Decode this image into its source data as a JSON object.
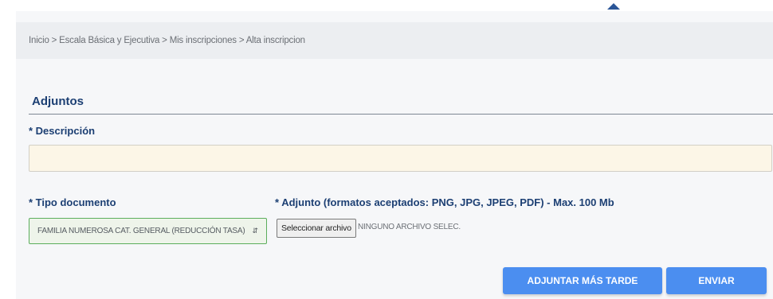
{
  "breadcrumb": {
    "text": "Inicio > Escala Básica y Ejecutiva > Mis inscripciones > Alta inscripcion"
  },
  "section": {
    "title": "Adjuntos"
  },
  "form": {
    "descripcion_label": "* Descripción",
    "descripcion_value": "",
    "tipo_documento_label": "* Tipo documento",
    "tipo_documento_selected": "FAMILIA NUMEROSA CAT. GENERAL (REDUCCIÓN TASA)",
    "adjunto_label": "* Adjunto (formatos aceptados: PNG, JPG, JPEG, PDF) - Max. 100 Mb",
    "file_button_label": "Seleccionar archivo",
    "file_status": "NINGUNO ARCHIVO SELEC."
  },
  "actions": {
    "later_label": "ADJUNTAR MÁS TARDE",
    "send_label": "ENVIAR"
  },
  "icons": {
    "top_caret": "caret-up-icon",
    "select_arrows": "select-arrows-icon"
  },
  "colors": {
    "accent": "#4b8ef0",
    "heading": "#1c3f73",
    "input_background": "#fcf6e7",
    "select_border": "#5cae5c"
  }
}
